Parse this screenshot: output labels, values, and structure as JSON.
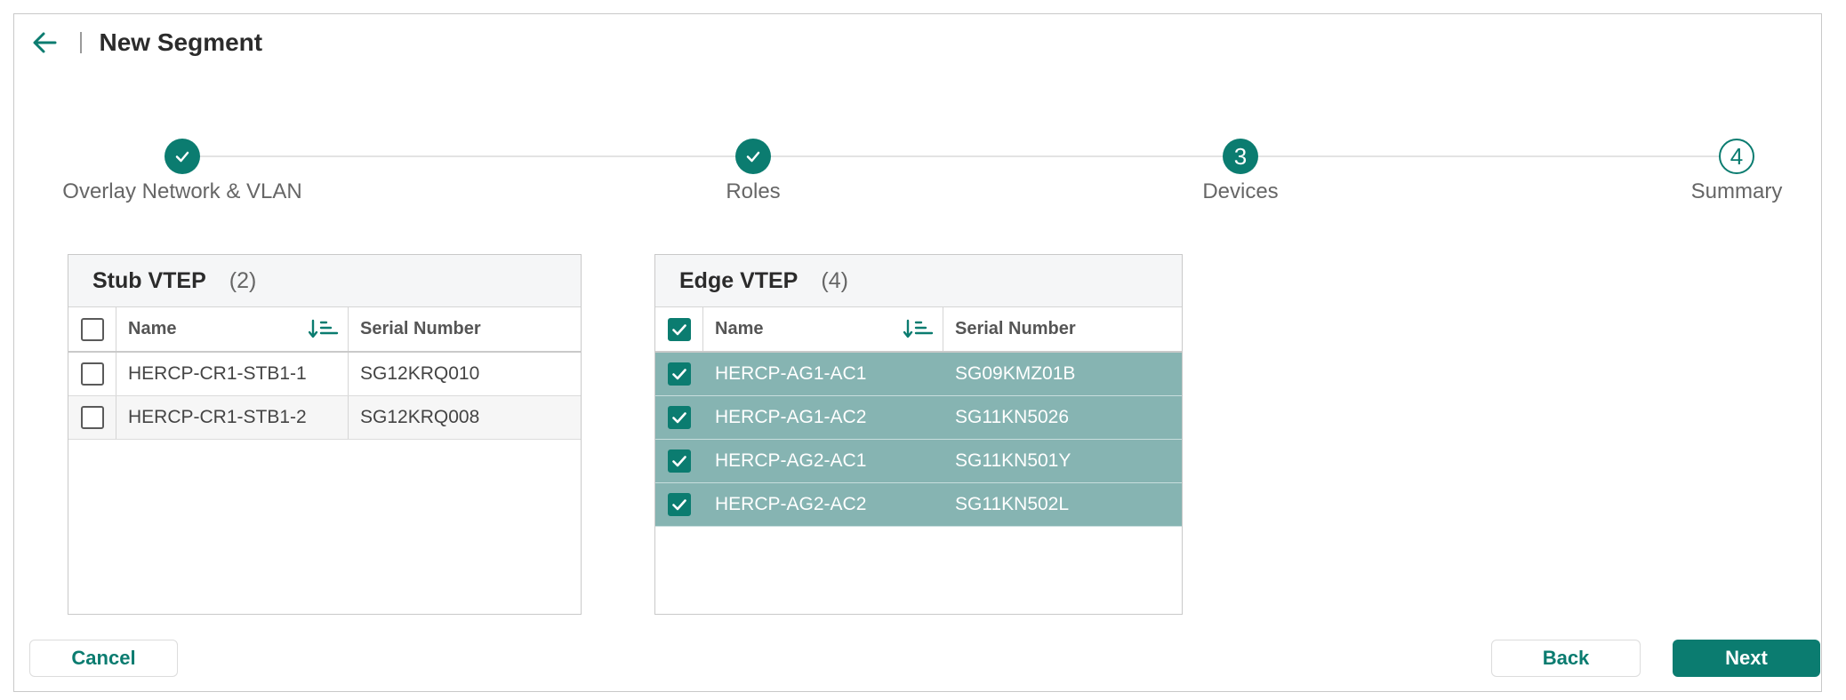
{
  "header": {
    "title": "New Segment"
  },
  "stepper": {
    "steps": [
      {
        "label": "Overlay Network & VLAN",
        "state": "done",
        "marker": ""
      },
      {
        "label": "Roles",
        "state": "done",
        "marker": ""
      },
      {
        "label": "Devices",
        "state": "active",
        "marker": "3"
      },
      {
        "label": "Summary",
        "state": "pending",
        "marker": "4"
      }
    ]
  },
  "stub_table": {
    "title": "Stub VTEP",
    "count": "(2)",
    "columns": {
      "name": "Name",
      "serial": "Serial Number"
    },
    "rows": [
      {
        "name": "HERCP-CR1-STB1-1",
        "serial": "SG12KRQ010",
        "checked": false
      },
      {
        "name": "HERCP-CR1-STB1-2",
        "serial": "SG12KRQ008",
        "checked": false
      }
    ]
  },
  "edge_table": {
    "title": "Edge VTEP",
    "count": "(4)",
    "columns": {
      "name": "Name",
      "serial": "Serial Number"
    },
    "rows": [
      {
        "name": "HERCP-AG1-AC1",
        "serial": "SG09KMZ01B",
        "checked": true
      },
      {
        "name": "HERCP-AG1-AC2",
        "serial": "SG11KN5026",
        "checked": true
      },
      {
        "name": "HERCP-AG2-AC1",
        "serial": "SG11KN501Y",
        "checked": true
      },
      {
        "name": "HERCP-AG2-AC2",
        "serial": "SG11KN502L",
        "checked": true
      }
    ]
  },
  "footer": {
    "cancel": "Cancel",
    "back": "Back",
    "next": "Next"
  },
  "colors": {
    "accent": "#0b7c70",
    "selected_row": "#86b4b2"
  }
}
